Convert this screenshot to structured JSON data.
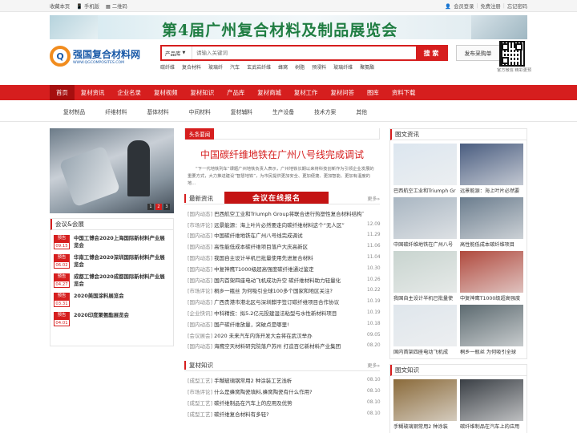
{
  "topbar": {
    "bookmark": "收藏本页",
    "mobile": "手机版",
    "qrcode": "二维码",
    "login": "会员登录",
    "register": "免费注册",
    "forgot": "忘记密码"
  },
  "banner": {
    "text": "第4届广州复合材料及制品展览会"
  },
  "logo": {
    "name": "强国复合材料网",
    "url": "WWW.QGCOMPOSITES.COM",
    "mark": "Q"
  },
  "search": {
    "category": "产品库",
    "placeholder": "请输入关键词",
    "button": "搜 索",
    "hot": [
      "碳纤维",
      "复合材料",
      "玻璃纤",
      "汽车",
      "玄武岩纤维",
      "蜂窝",
      "树脂",
      "预浸料",
      "玻璃纤维",
      "聚氨酯"
    ]
  },
  "publish": "发布采购单",
  "qr": {
    "caption": "官方微信 精彩更预"
  },
  "nav": [
    "首页",
    "复材资讯",
    "企业名录",
    "复材视频",
    "复材知识",
    "产品库",
    "复材商城",
    "复材工作",
    "复材问答",
    "图库",
    "资料下载"
  ],
  "subnav": [
    "复材制品",
    "纤维材料",
    "基体材料",
    "中间材料",
    "复材辅料",
    "生产设备",
    "技术方案",
    "其他"
  ],
  "slider": {
    "pages": [
      "1",
      "2",
      "3"
    ]
  },
  "conference": {
    "title": "会议&会展",
    "items": [
      {
        "tag": "预告",
        "date": "09.15",
        "title": "中国工博会2020上海国际新材料产业展览会"
      },
      {
        "tag": "预告",
        "date": "06.02",
        "title": "华南工博会2020深圳国际新材料产业展览会"
      },
      {
        "tag": "预告",
        "date": "04.27",
        "title": "成都工博会2020成都国际新材料产业展览会"
      },
      {
        "tag": "预告",
        "date": "03.31",
        "title": "2020美国涂料展览会"
      },
      {
        "tag": "预告",
        "date": "04.01",
        "title": "2020印度聚氨酯展览会"
      }
    ]
  },
  "headlines": {
    "label": "头条要闻",
    "title": "中国碳纤维地铁在广州八号线完成调试",
    "desc": "“下一代地铁列车”课题广州地铁负责人表示，广州地铁长期以来将科技创新作为引领企业发展的重要方式，大力推进建设“智慧地铁”，为市民提供更加安全、更加便捷、更加智能、更加有温度的地..."
  },
  "latest": {
    "title": "最新资讯",
    "ad": "会议在线报名",
    "more": "更多»",
    "items": [
      {
        "cat": "[国内动态]",
        "title": "巴西航空工业和Triumph Group将联合进行热塑性复合材料结构飞",
        "date": ""
      },
      {
        "cat": "[市场评论]",
        "title": "远景能源：海上叶片必然要走向碳纤维材料这个“无人区”",
        "date": "12.09"
      },
      {
        "cat": "[国内动态]",
        "title": "中国碳纤维地铁在广州八号线完成调试",
        "date": "11.29"
      },
      {
        "cat": "[国内动态]",
        "title": "高性能低成本碳纤维项目落户大庆高新区",
        "date": "11.06"
      },
      {
        "cat": "[国内动态]",
        "title": "我国自主设计半机已批量使用先进复合材料",
        "date": "11.04"
      },
      {
        "cat": "[国内动态]",
        "title": "中复神鹰T1000级超高强度碳纤维通过鉴定",
        "date": "10.30"
      },
      {
        "cat": "[国内动态]",
        "title": "国内首架四座电动飞机成功升空 碳纤维材料助力轻量化",
        "date": "10.26"
      },
      {
        "cat": "[市场评论]",
        "title": "桐乡一瓶丝 为何吸引全球100多个国家和地区关注?",
        "date": "10.22"
      },
      {
        "cat": "[国内动态]",
        "title": "广西贵港市港北区与深圳麒宇签订碳纤维项目合作协议",
        "date": "10.19"
      },
      {
        "cat": "[企业快讯]",
        "title": "中科精技：拟5.2亿元投建湿法粘型与水性新材料项目",
        "date": "10.19"
      },
      {
        "cat": "[国内动态]",
        "title": "国产碳纤维放量，突破点是哪里!",
        "date": "10.18"
      },
      {
        "cat": "[会议展会]",
        "title": "2020 未来汽车内饰开发大会将在武汉举办",
        "date": "09.05"
      },
      {
        "cat": "[国内动态]",
        "title": "海鹰空天材料研究院落户苏州 打造百亿新材料产业集团",
        "date": "08.20"
      }
    ]
  },
  "knowledge": {
    "title": "复材知识",
    "more": "更多»",
    "items": [
      {
        "cat": "[成型工艺]",
        "title": "手糊玻璃钢常用2 种涂装工艺浅析",
        "date": "08.10"
      },
      {
        "cat": "[市场评论]",
        "title": "什么是蜂窝陶瓷填料,蜂窝陶瓷有什么作用?",
        "date": "08.10"
      },
      {
        "cat": "[成型工艺]",
        "title": "碳纤维制品在汽车上的应用及优势",
        "date": "08.10"
      },
      {
        "cat": "[成型工艺]",
        "title": "碳纤维复合材料有多轻?",
        "date": "08.10"
      }
    ]
  },
  "pictures": {
    "title": "图文资讯",
    "items": [
      {
        "caption": "巴西航空工业和Triumph Gr",
        "bg": "#dce6ef"
      },
      {
        "caption": "远景能源：海上叶片必然要",
        "bg": "#4a5d80"
      },
      {
        "caption": "中国碳纤维地铁在广州八号",
        "bg": "#a9b6c2"
      },
      {
        "caption": "高性能低成本碳纤维项目",
        "bg": "#6b7d8e"
      },
      {
        "caption": "我国自主设计半机已批量使",
        "bg": "#c8d4cf"
      },
      {
        "caption": "中复神鹰T1000级超高强度",
        "bg": "#b04a3e"
      },
      {
        "caption": "国内首架四座电动飞机成",
        "bg": "#dfe6ec"
      },
      {
        "caption": "桐乡一瓶丝 为何吸引全球",
        "bg": "#5c6a70"
      }
    ]
  },
  "pictures2": {
    "title": "图文知识",
    "items": [
      {
        "caption": "手糊玻璃钢常用2 种涂装",
        "bg": "#8a6a3a"
      },
      {
        "caption": "碳纤维制品在汽车上的应用",
        "bg": "#3a3f45"
      }
    ]
  },
  "colors": {
    "accent": "#d61e1e",
    "nav_active": "#a60f0f",
    "logo_blue": "#1a5aa8",
    "logo_orange": "#f18c1e",
    "banner_text": "#1f7d42"
  }
}
